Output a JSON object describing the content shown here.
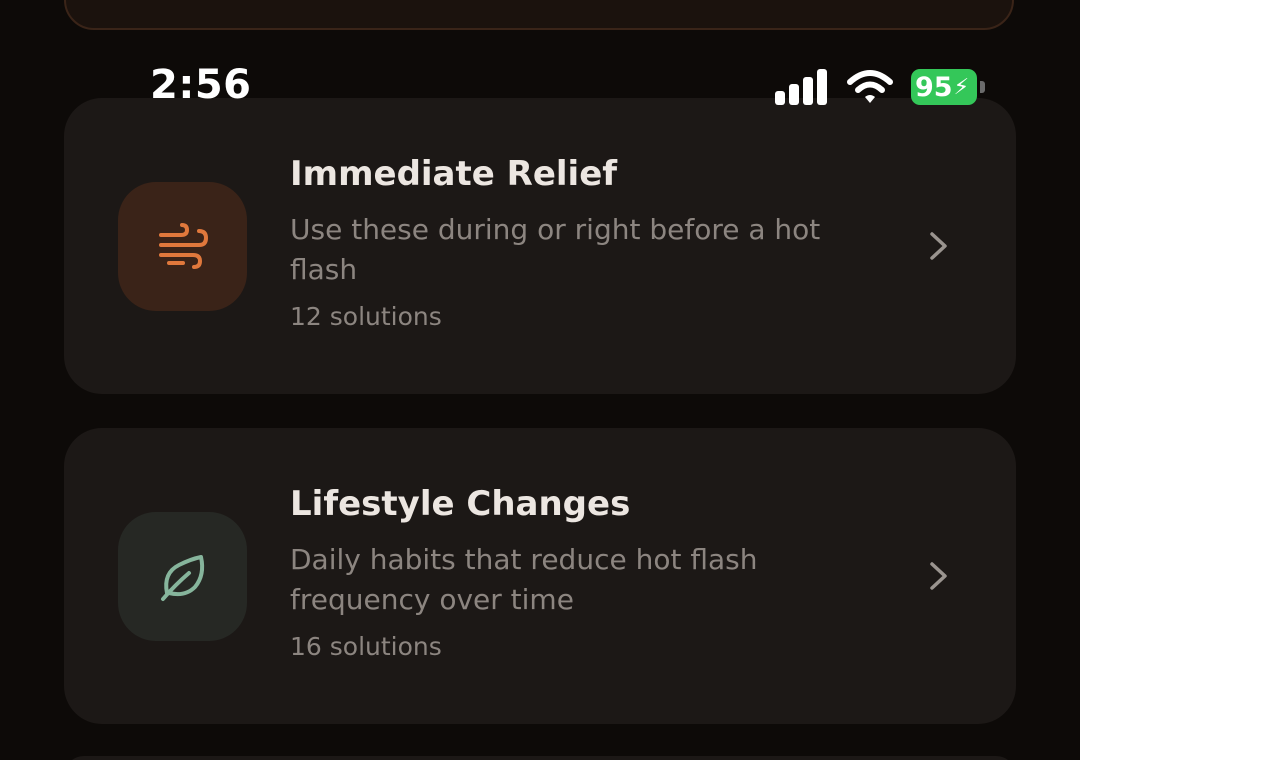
{
  "status_bar": {
    "time": "2:56",
    "battery": "95",
    "battery_color": "#34c759"
  },
  "categories": [
    {
      "title": "Immediate Relief",
      "description": "Use these during or right before a hot flash",
      "count": "12 solutions",
      "icon": "wind-icon",
      "icon_color": "#e0783c",
      "tile_color": "#3a2318"
    },
    {
      "title": "Lifestyle Changes",
      "description": "Daily habits that reduce hot flash frequency over time",
      "count": "16 solutions",
      "icon": "leaf-icon",
      "icon_color": "#86b59c",
      "tile_color": "#262824"
    }
  ]
}
